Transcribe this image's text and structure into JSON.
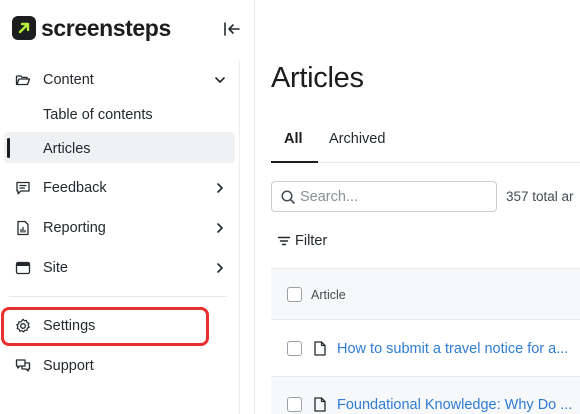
{
  "brand": {
    "name": "screensteps"
  },
  "sidebar": {
    "items": [
      {
        "label": "Content",
        "icon": "folder-open-icon",
        "expanded": true
      },
      {
        "label": "Feedback",
        "icon": "message-square-icon"
      },
      {
        "label": "Reporting",
        "icon": "report-document-icon"
      },
      {
        "label": "Site",
        "icon": "browser-window-icon"
      },
      {
        "label": "Settings",
        "icon": "gear-icon",
        "highlighted": true
      },
      {
        "label": "Support",
        "icon": "support-chat-icon"
      }
    ],
    "content_children": [
      {
        "label": "Table of contents"
      },
      {
        "label": "Articles",
        "active": true
      }
    ]
  },
  "main": {
    "title": "Articles",
    "tabs": [
      {
        "label": "All",
        "active": true
      },
      {
        "label": "Archived"
      }
    ],
    "search": {
      "placeholder": "Search...",
      "value": ""
    },
    "total_text": "357 total ar",
    "filter_label": "Filter",
    "table": {
      "column_header": "Article",
      "rows": [
        {
          "title": "How to submit a travel notice for a..."
        },
        {
          "title": "Foundational Knowledge: Why Do ..."
        }
      ]
    }
  },
  "colors": {
    "accent_link": "#2f7cd3",
    "brand_mark": "#1b1d1f",
    "brand_arrow": "#b6f03a",
    "highlight_ring": "#e8312f"
  }
}
